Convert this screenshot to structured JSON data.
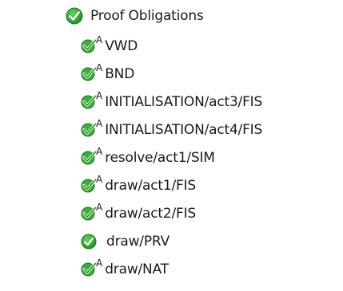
{
  "tree": {
    "root": {
      "label": "Proof Obligations",
      "icon": "green-check-circle-icon",
      "check_color": "#2e9d2e"
    },
    "items": [
      {
        "label": "VWD",
        "marker": "A",
        "icon": "green-check-circle-icon"
      },
      {
        "label": "BND",
        "marker": "A",
        "icon": "green-check-circle-icon"
      },
      {
        "label": "INITIALISATION/act3/FIS",
        "marker": "A",
        "icon": "green-check-circle-icon"
      },
      {
        "label": "INITIALISATION/act4/FIS",
        "marker": "A",
        "icon": "green-check-circle-icon"
      },
      {
        "label": "resolve/act1/SIM",
        "marker": "A",
        "icon": "green-check-circle-icon"
      },
      {
        "label": "draw/act1/FIS",
        "marker": "A",
        "icon": "green-check-circle-icon"
      },
      {
        "label": "draw/act2/FIS",
        "marker": "A",
        "icon": "green-check-circle-icon"
      },
      {
        "label": "draw/PRV",
        "marker": "",
        "icon": "green-check-circle-icon"
      },
      {
        "label": "draw/NAT",
        "marker": "A",
        "icon": "green-check-circle-icon"
      }
    ]
  }
}
